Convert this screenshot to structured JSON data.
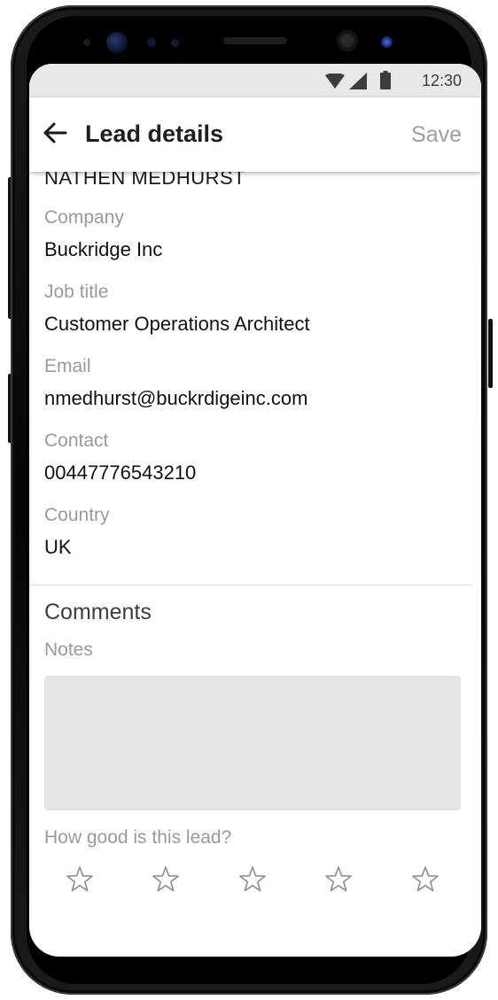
{
  "status_bar": {
    "time": "12:30",
    "icons": [
      "wifi-icon",
      "signal-icon",
      "battery-icon"
    ]
  },
  "app_bar": {
    "back_icon": "arrow-left-icon",
    "title": "Lead details",
    "save_label": "Save"
  },
  "lead": {
    "name": "NATHEN MEDHURST",
    "fields": [
      {
        "label": "Company",
        "value": "Buckridge Inc"
      },
      {
        "label": "Job title",
        "value": "Customer Operations Architect"
      },
      {
        "label": "Email",
        "value": "nmedhurst@buckrdigeinc.com"
      },
      {
        "label": "Contact",
        "value": "00447776543210"
      },
      {
        "label": "Country",
        "value": "UK"
      }
    ]
  },
  "comments": {
    "section_title": "Comments",
    "notes_label": "Notes",
    "notes_value": ""
  },
  "rating": {
    "question": "How good is this lead?",
    "max_stars": 5,
    "selected": 0,
    "star_icon": "star-outline-icon"
  },
  "colors": {
    "status_bar_bg": "#e8e8e8",
    "label_gray": "#9a9a9a",
    "notes_bg": "#e5e5e6",
    "save_disabled": "#9e9e9e"
  }
}
